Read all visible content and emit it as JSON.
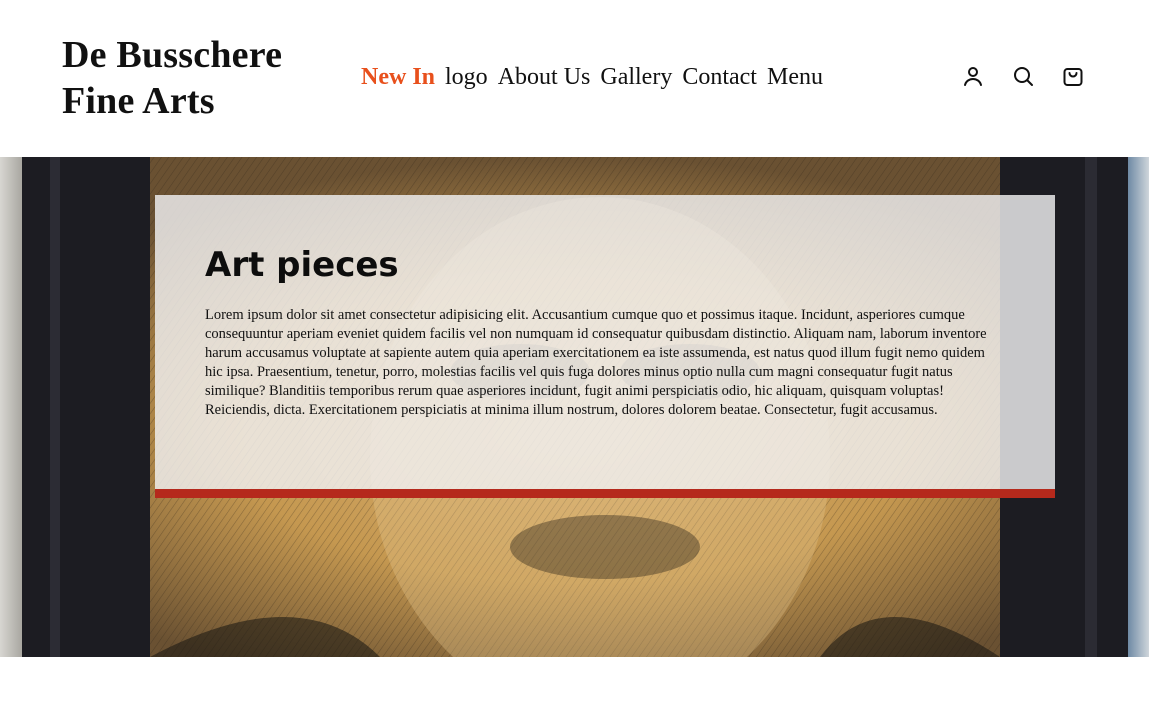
{
  "header": {
    "brand_line1": "De Busschere",
    "brand_line2": "Fine Arts",
    "nav": [
      {
        "label": "New In"
      },
      {
        "label": "logo"
      },
      {
        "label": "About Us"
      },
      {
        "label": "Gallery"
      },
      {
        "label": "Contact"
      },
      {
        "label": "Menu"
      }
    ],
    "icons": [
      "account-icon",
      "search-icon",
      "shopping-bag-icon"
    ]
  },
  "hero": {
    "title": "Art pieces",
    "body": "Lorem ipsum dolor sit amet consectetur adipisicing elit. Accusantium cumque quo et possimus itaque. Incidunt, asperiores cumque consequuntur aperiam eveniet quidem facilis vel non numquam id consequatur quibusdam distinctio. Aliquam nam, laborum inventore harum accusamus voluptate at sapiente autem quia aperiam exercitationem ea iste assumenda, est natus quod illum fugit nemo quidem hic ipsa. Praesentium, tenetur, porro, molestias facilis vel quis fuga dolores minus optio nulla cum magni consequatur fugit natus similique? Blanditiis temporibus rerum quae asperiores incidunt, fugit animi perspiciatis odio, hic aliquam, quisquam voluptas! Reiciendis, dicta. Exercitationem perspiciatis at minima illum nostrum, dolores dolorem beatae. Consectetur, fugit accusamus."
  },
  "colors": {
    "accent": "#e8501c",
    "panel_border": "#b5291c"
  }
}
